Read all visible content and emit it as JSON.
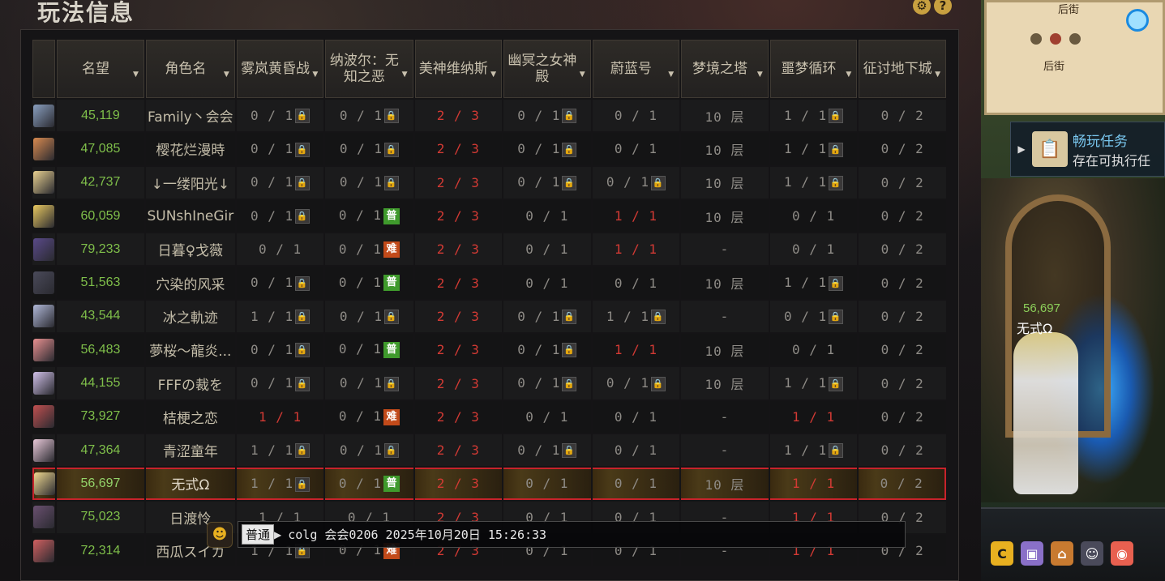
{
  "panel": {
    "title": "玩法信息",
    "settings_glyph": "⚙",
    "help_glyph": "?"
  },
  "columns": [
    {
      "label": "名望"
    },
    {
      "label": "角色名"
    },
    {
      "label": "雾岚黄昏战"
    },
    {
      "label": "纳波尔：无知之恶"
    },
    {
      "label": "美神维纳斯"
    },
    {
      "label": "幽冥之女神殿"
    },
    {
      "label": "蔚蓝号"
    },
    {
      "label": "梦境之塔"
    },
    {
      "label": "噩梦循环"
    },
    {
      "label": "征讨地下城"
    }
  ],
  "badges": {
    "normal": "普",
    "hard": "难"
  },
  "rows": [
    {
      "fame": "45,119",
      "name": "Family丶会会",
      "c": [
        "0 / 1",
        "0 / 1",
        "2 / 3",
        "0 / 1",
        "0 / 1",
        "10 层",
        "1 / 1",
        "0 / 2"
      ],
      "lock": [
        1,
        1,
        0,
        1,
        0,
        0,
        1,
        0
      ],
      "red": [
        0,
        0,
        1,
        0,
        0,
        0,
        0,
        0
      ],
      "badge": "",
      "av": "#8aa0c0"
    },
    {
      "fame": "47,085",
      "name": "樱花烂漫時",
      "c": [
        "0 / 1",
        "0 / 1",
        "2 / 3",
        "0 / 1",
        "0 / 1",
        "10 层",
        "1 / 1",
        "0 / 2"
      ],
      "lock": [
        1,
        1,
        0,
        1,
        0,
        0,
        1,
        0
      ],
      "red": [
        0,
        0,
        1,
        0,
        0,
        0,
        0,
        0
      ],
      "badge": "",
      "av": "#d88a50"
    },
    {
      "fame": "42,737",
      "name": "↓一缕阳光↓",
      "c": [
        "0 / 1",
        "0 / 1",
        "2 / 3",
        "0 / 1",
        "0 / 1",
        "10 层",
        "1 / 1",
        "0 / 2"
      ],
      "lock": [
        1,
        1,
        0,
        1,
        1,
        0,
        1,
        0
      ],
      "red": [
        0,
        0,
        1,
        0,
        0,
        0,
        0,
        0
      ],
      "badge": "",
      "av": "#e8d090"
    },
    {
      "fame": "60,059",
      "name": "SUNshIneGir",
      "c": [
        "0 / 1",
        "0 / 1",
        "2 / 3",
        "0 / 1",
        "1 / 1",
        "10 层",
        "0 / 1",
        "0 / 2"
      ],
      "lock": [
        1,
        0,
        0,
        0,
        0,
        0,
        0,
        0
      ],
      "red": [
        0,
        0,
        1,
        0,
        1,
        0,
        0,
        0
      ],
      "badge": "normal",
      "av": "#e8c860"
    },
    {
      "fame": "79,233",
      "name": "日暮♀戈薇",
      "c": [
        "0 / 1",
        "0 / 1",
        "2 / 3",
        "0 / 1",
        "1 / 1",
        "-",
        "0 / 1",
        "0 / 2"
      ],
      "lock": [
        0,
        0,
        0,
        0,
        0,
        0,
        0,
        0
      ],
      "red": [
        0,
        0,
        1,
        0,
        1,
        0,
        0,
        0
      ],
      "badge": "hard",
      "av": "#5a4a8a"
    },
    {
      "fame": "51,563",
      "name": "穴染的风采",
      "c": [
        "0 / 1",
        "0 / 1",
        "2 / 3",
        "0 / 1",
        "0 / 1",
        "10 层",
        "1 / 1",
        "0 / 2"
      ],
      "lock": [
        1,
        0,
        0,
        0,
        0,
        0,
        1,
        0
      ],
      "red": [
        0,
        0,
        1,
        0,
        0,
        0,
        0,
        0
      ],
      "badge": "normal",
      "av": "#4a4a5a"
    },
    {
      "fame": "43,544",
      "name": "冰之軌迹",
      "c": [
        "1 / 1",
        "0 / 1",
        "2 / 3",
        "0 / 1",
        "1 / 1",
        "-",
        "0 / 1",
        "0 / 2"
      ],
      "lock": [
        1,
        1,
        0,
        1,
        1,
        0,
        1,
        0
      ],
      "red": [
        0,
        0,
        1,
        0,
        0,
        0,
        0,
        0
      ],
      "badge": "",
      "av": "#b0b8d8"
    },
    {
      "fame": "56,483",
      "name": "夢桜～龍炎...",
      "c": [
        "0 / 1",
        "0 / 1",
        "2 / 3",
        "0 / 1",
        "1 / 1",
        "10 层",
        "0 / 1",
        "0 / 2"
      ],
      "lock": [
        1,
        0,
        0,
        1,
        0,
        0,
        0,
        0
      ],
      "red": [
        0,
        0,
        1,
        0,
        1,
        0,
        0,
        0
      ],
      "badge": "normal",
      "av": "#e89090"
    },
    {
      "fame": "44,155",
      "name": "FFFの裁を",
      "c": [
        "0 / 1",
        "0 / 1",
        "2 / 3",
        "0 / 1",
        "0 / 1",
        "10 层",
        "1 / 1",
        "0 / 2"
      ],
      "lock": [
        1,
        1,
        0,
        1,
        1,
        0,
        1,
        0
      ],
      "red": [
        0,
        0,
        1,
        0,
        0,
        0,
        0,
        0
      ],
      "badge": "",
      "av": "#d0c0e8"
    },
    {
      "fame": "73,927",
      "name": "桔梗之恋",
      "c": [
        "1 / 1",
        "0 / 1",
        "2 / 3",
        "0 / 1",
        "0 / 1",
        "-",
        "1 / 1",
        "0 / 2"
      ],
      "lock": [
        0,
        0,
        0,
        0,
        0,
        0,
        0,
        0
      ],
      "red": [
        1,
        0,
        1,
        0,
        0,
        0,
        1,
        0
      ],
      "badge": "hard",
      "av": "#c05050"
    },
    {
      "fame": "47,364",
      "name": "青涩童年",
      "c": [
        "1 / 1",
        "0 / 1",
        "2 / 3",
        "0 / 1",
        "0 / 1",
        "-",
        "1 / 1",
        "0 / 2"
      ],
      "lock": [
        1,
        1,
        0,
        1,
        0,
        0,
        1,
        0
      ],
      "red": [
        0,
        0,
        1,
        0,
        0,
        0,
        0,
        0
      ],
      "badge": "",
      "av": "#e8c8d8"
    },
    {
      "fame": "56,697",
      "name": "无式Ω",
      "c": [
        "1 / 1",
        "0 / 1",
        "2 / 3",
        "0 / 1",
        "0 / 1",
        "10 层",
        "1 / 1",
        "0 / 2"
      ],
      "lock": [
        1,
        0,
        0,
        0,
        0,
        0,
        0,
        0
      ],
      "red": [
        0,
        0,
        1,
        0,
        0,
        0,
        1,
        0
      ],
      "badge": "normal",
      "av": "#f0d890",
      "selected": true
    },
    {
      "fame": "75,023",
      "name": "日渡怜",
      "c": [
        "1 / 1",
        "0 / 1",
        "2 / 3",
        "0 / 1",
        "0 / 1",
        "-",
        "1 / 1",
        "0 / 2"
      ],
      "lock": [
        0,
        0,
        0,
        0,
        0,
        0,
        0,
        0
      ],
      "red": [
        0,
        0,
        1,
        0,
        0,
        0,
        1,
        0
      ],
      "badge": "",
      "av": "#6a5070"
    },
    {
      "fame": "72,314",
      "name": "西瓜スイカ",
      "c": [
        "1 / 1",
        "0 / 1",
        "2 / 3",
        "0 / 1",
        "0 / 1",
        "-",
        "1 / 1",
        "0 / 2"
      ],
      "lock": [
        1,
        0,
        0,
        0,
        0,
        0,
        0,
        0
      ],
      "red": [
        0,
        0,
        1,
        0,
        0,
        0,
        1,
        0
      ],
      "badge": "hard",
      "av": "#d06060"
    }
  ],
  "chat": {
    "channel": "普通",
    "message": "colg 会会0206 2025年10月20日 15:26:33"
  },
  "minimap": {
    "location_top": "后街",
    "location_left": "后街"
  },
  "quest": {
    "title": "畅玩任务",
    "description": "存在可执行任"
  },
  "hero": {
    "fame": "56,697",
    "name": "无式Ω"
  },
  "hud": {
    "icons": [
      "coin-icon",
      "card-icon",
      "home-icon",
      "character-icon",
      "pig-icon"
    ],
    "home_badge": "!"
  }
}
